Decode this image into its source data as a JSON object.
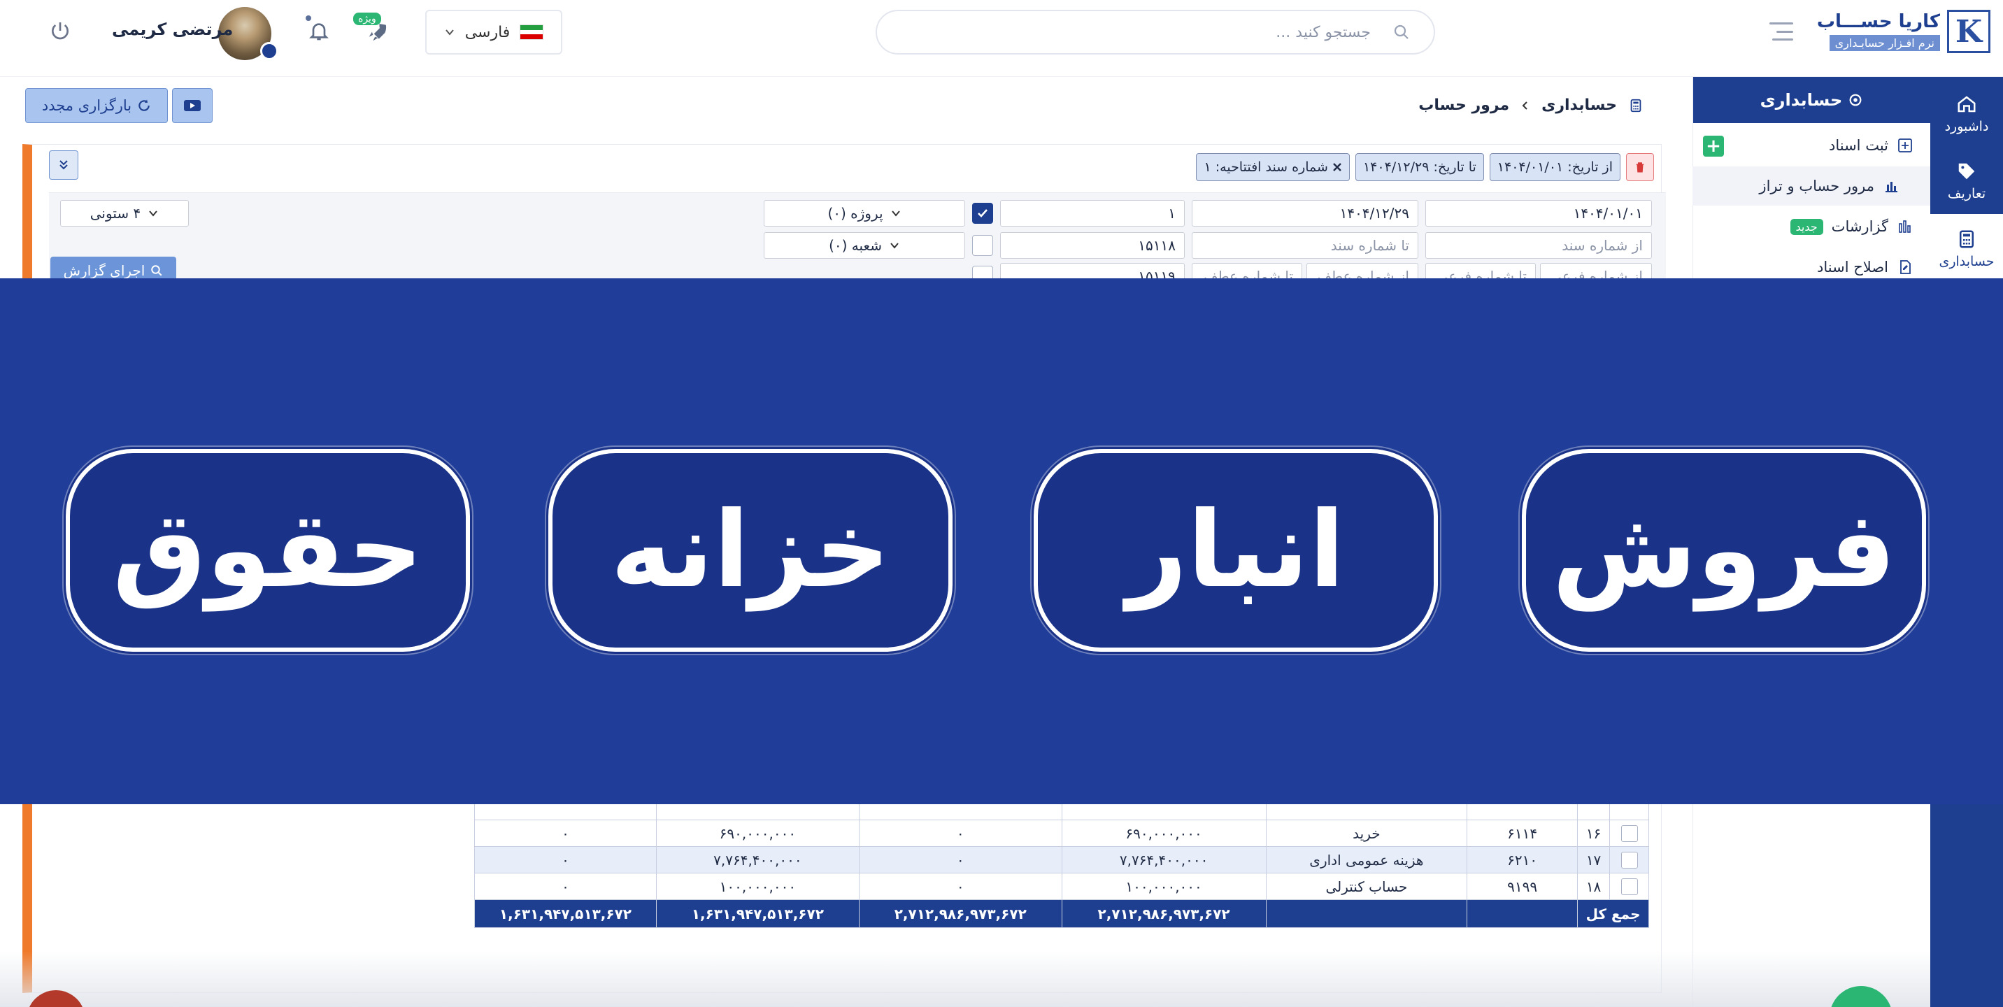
{
  "brand": {
    "name": "کاریا حســـاب",
    "tagline": "نرم افـزار حسابـداری",
    "logo_letter": "K"
  },
  "search": {
    "placeholder": "جستجو کنید ..."
  },
  "language": {
    "label": "فارسی"
  },
  "notifications": {
    "badge": "ویژه"
  },
  "user": {
    "name": "مرتضی کریمی"
  },
  "rail": [
    {
      "label": "داشبورد",
      "icon": "home-icon"
    },
    {
      "label": "تعاریف",
      "icon": "tag-icon"
    },
    {
      "label": "حسابداری",
      "icon": "calculator-icon"
    }
  ],
  "menu": {
    "title": "حسابداری",
    "items": [
      {
        "label": "ثبت اسناد",
        "icon": "plus-square-icon"
      },
      {
        "label": "مرور حساب و تراز",
        "icon": "bar-chart-icon"
      },
      {
        "label": "گزارشات",
        "icon": "chart-icon",
        "badge": "جدید"
      },
      {
        "label": "اصلاح اسناد",
        "icon": "document-edit-icon"
      }
    ]
  },
  "breadcrumb": {
    "root": "حسابداری",
    "current": "مرور حساب"
  },
  "toolbar": {
    "reload": "بارگزاری مجدد"
  },
  "chips": [
    {
      "label": "از تاریخ: ۱۴۰۴/۰۱/۰۱"
    },
    {
      "label": "تا تاریخ: ۱۴۰۴/۱۲/۲۹"
    },
    {
      "label": "شماره سند افتتاحیه: ۱"
    }
  ],
  "filters": {
    "from_date": "۱۴۰۴/۰۱/۰۱",
    "to_date": "۱۴۰۴/۱۲/۲۹",
    "opening_doc": "۱",
    "project": "پروژه (۰)",
    "from_doc_ph": "از شماره سند",
    "to_doc_ph": "تا شماره سند",
    "doc_value": "۱۵۱۱۸",
    "branch": "شعبه (۰)",
    "from_sub_ph": "از شماره فرعی",
    "to_sub_ph": "تا شماره فرعی",
    "from_ref_ph": "از شماره عطف",
    "to_ref_ph": "تا شماره عطف",
    "ref_value": "۱۵۱۱۹",
    "columns": "۴ ستونی",
    "run": "اجرای گزارش"
  },
  "table": {
    "rows": [
      {
        "idx": "۱۶",
        "code": "۶۱۱۴",
        "title": "خرید",
        "debit": "۶۹۰,۰۰۰,۰۰۰",
        "credit": "۰",
        "bal_debit": "۶۹۰,۰۰۰,۰۰۰",
        "bal_credit": "۰"
      },
      {
        "idx": "۱۷",
        "code": "۶۲۱۰",
        "title": "هزینه عمومی اداری",
        "debit": "۷,۷۶۴,۴۰۰,۰۰۰",
        "credit": "۰",
        "bal_debit": "۷,۷۶۴,۴۰۰,۰۰۰",
        "bal_credit": "۰"
      },
      {
        "idx": "۱۸",
        "code": "۹۱۹۹",
        "title": "حساب کنترلی",
        "debit": "۱۰۰,۰۰۰,۰۰۰",
        "credit": "۰",
        "bal_debit": "۱۰۰,۰۰۰,۰۰۰",
        "bal_credit": "۰"
      }
    ],
    "total": {
      "label": "جمع کل",
      "debit": "۲,۷۱۲,۹۸۶,۹۷۳,۶۷۲",
      "credit": "۲,۷۱۲,۹۸۶,۹۷۳,۶۷۲",
      "bal_debit": "۱,۶۳۱,۹۴۷,۵۱۳,۶۷۲",
      "bal_credit": "۱,۶۳۱,۹۴۷,۵۱۳,۶۷۲"
    }
  },
  "banner": {
    "items": [
      "فروش",
      "انبار",
      "خزانه",
      "حقوق"
    ]
  },
  "colors": {
    "primary": "#1e3f8f",
    "accent": "#f07a2b",
    "success": "#2bb673",
    "banner": "#1f3d99"
  }
}
